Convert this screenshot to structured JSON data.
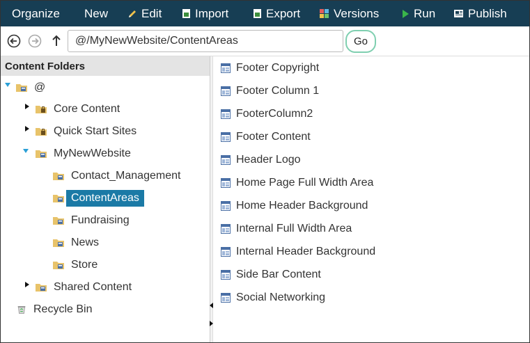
{
  "toolbar": {
    "organize": "Organize",
    "new": "New",
    "edit": "Edit",
    "import": "Import",
    "export": "Export",
    "versions": "Versions",
    "run": "Run",
    "publish": "Publish"
  },
  "address": {
    "path": "@/MyNewWebsite/ContentAreas",
    "go": "Go"
  },
  "left": {
    "header": "Content Folders",
    "root": "@",
    "core": "Core Content",
    "quick": "Quick Start Sites",
    "site": "MyNewWebsite",
    "children": [
      "Contact_Management",
      "ContentAreas",
      "Fundraising",
      "News",
      "Store"
    ],
    "shared": "Shared Content",
    "recycle": "Recycle Bin"
  },
  "items": [
    "Footer Copyright",
    "Footer Column 1",
    "FooterColumn2",
    "Footer Content",
    "Header Logo",
    "Home Page Full Width Area",
    "Home Header Background",
    "Internal Full Width Area",
    "Internal Header Background",
    "Side Bar Content",
    "Social Networking"
  ],
  "colors": {
    "toolbar": "#173e54",
    "selected": "#1b7aa6",
    "folder": "#e8c36a",
    "go_border": "#7fcfb0"
  }
}
